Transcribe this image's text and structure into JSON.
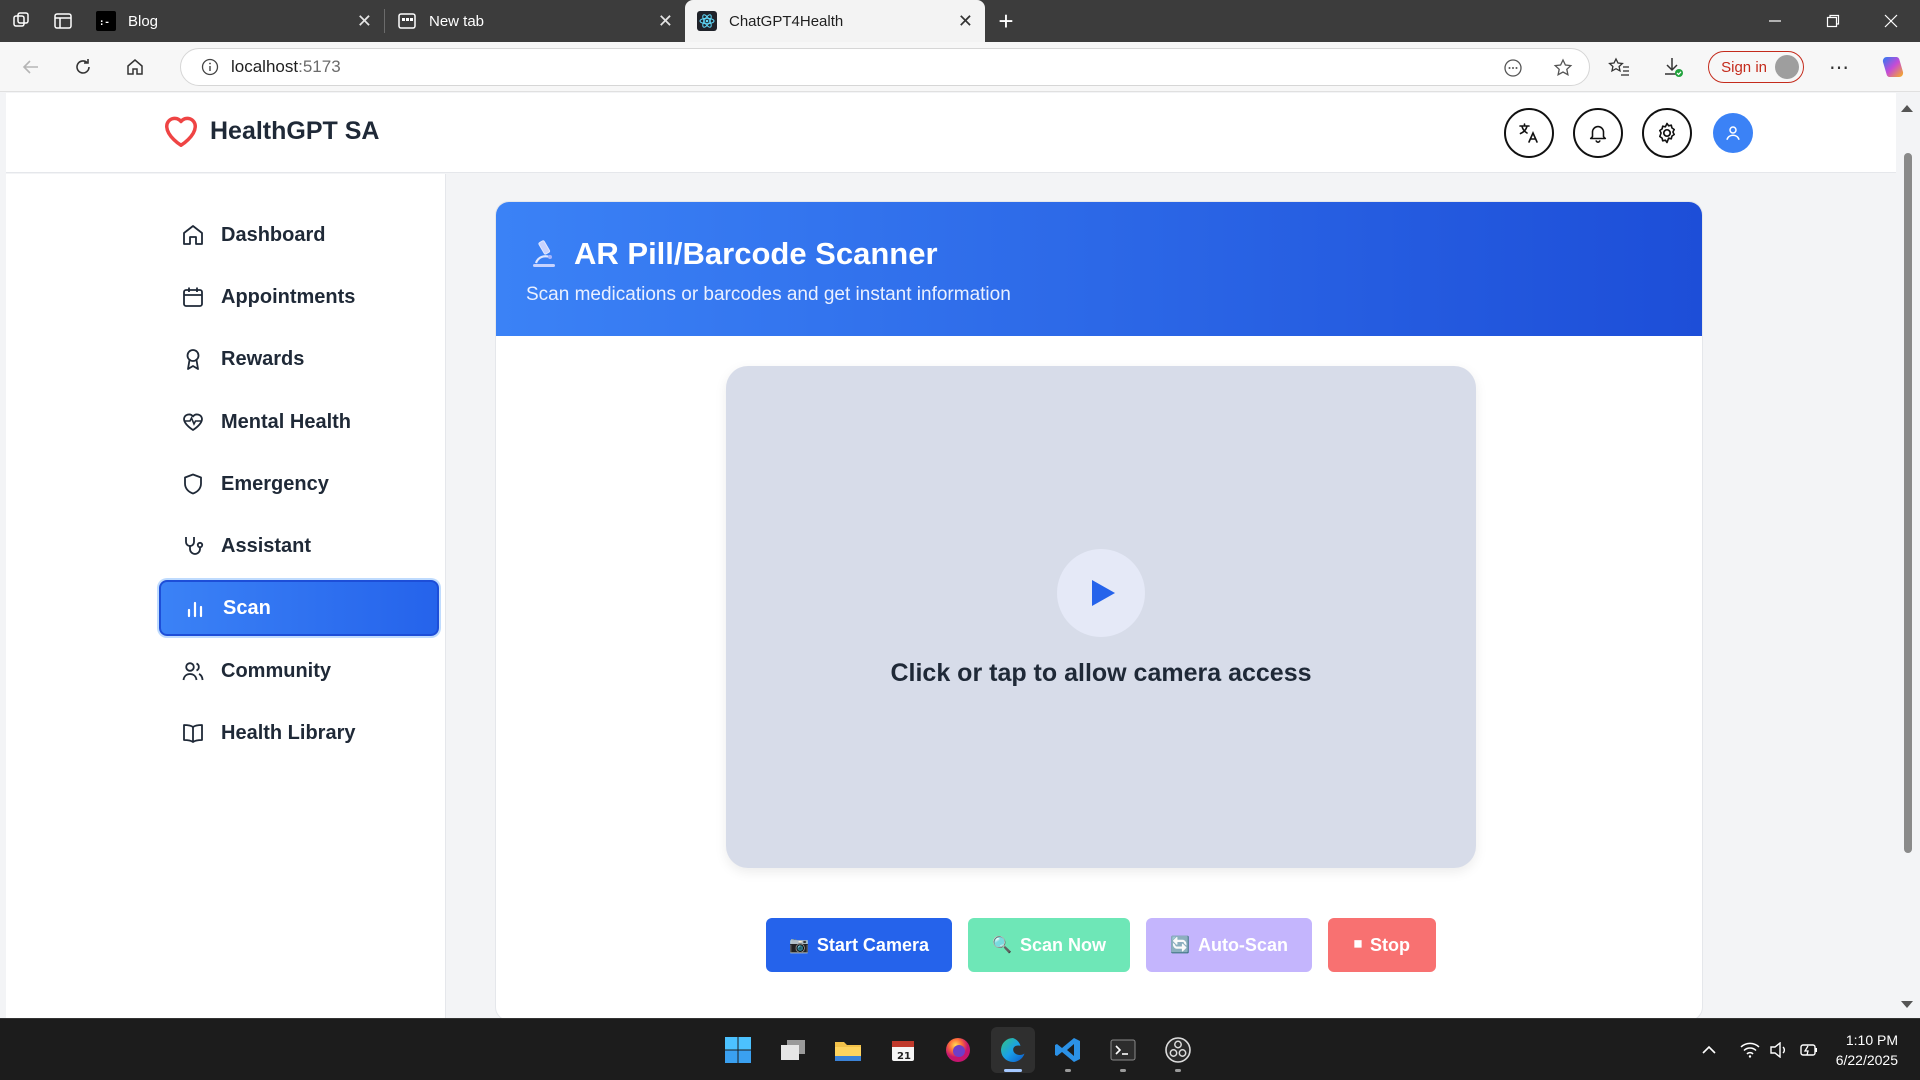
{
  "browser": {
    "tabs": [
      {
        "title": "Blog",
        "icon": "dev-logo-icon",
        "active": false
      },
      {
        "title": "New tab",
        "icon": "newtab-page-icon",
        "active": false
      },
      {
        "title": "ChatGPT4Health",
        "icon": "react-logo-icon",
        "active": true
      }
    ],
    "url_host": "localhost",
    "url_port": ":5173",
    "sign_in": "Sign in"
  },
  "app": {
    "brand": "HealthGPT SA",
    "brand_color": "#ef4444",
    "accent": "#3b82f6",
    "header_icons": [
      "translate-icon",
      "bell-icon",
      "settings-icon",
      "user-icon"
    ],
    "sidebar": {
      "items": [
        {
          "label": "Dashboard",
          "icon": "home-icon"
        },
        {
          "label": "Appointments",
          "icon": "calendar-icon"
        },
        {
          "label": "Rewards",
          "icon": "award-icon"
        },
        {
          "label": "Mental Health",
          "icon": "heart-pulse-icon"
        },
        {
          "label": "Emergency",
          "icon": "shield-icon"
        },
        {
          "label": "Assistant",
          "icon": "stethoscope-icon"
        },
        {
          "label": "Scan",
          "icon": "bar-chart-icon",
          "active": true
        },
        {
          "label": "Community",
          "icon": "users-icon"
        },
        {
          "label": "Health Library",
          "icon": "book-icon"
        }
      ]
    },
    "scanner": {
      "title": "AR Pill/Barcode Scanner",
      "subtitle": "Scan medications or barcodes and get instant information",
      "camera_prompt": "Click or tap to allow camera access",
      "buttons": {
        "start": {
          "label": "Start Camera",
          "icon": "📷",
          "color": "#2563eb"
        },
        "scan": {
          "label": "Scan Now",
          "icon": "🔍",
          "color": "#6ee7b7"
        },
        "auto": {
          "label": "Auto-Scan",
          "icon": "🔄",
          "color": "#c4b5fd"
        },
        "stop": {
          "label": "Stop",
          "icon": "⏹",
          "color": "#f87171"
        }
      }
    }
  },
  "taskbar": {
    "apps": [
      "windows-start-icon",
      "task-view-icon",
      "file-explorer-icon",
      "calendar-app-icon",
      "firefox-icon",
      "edge-icon",
      "vscode-icon",
      "terminal-icon",
      "obs-icon"
    ],
    "time": "1:10 PM",
    "date": "6/22/2025"
  }
}
